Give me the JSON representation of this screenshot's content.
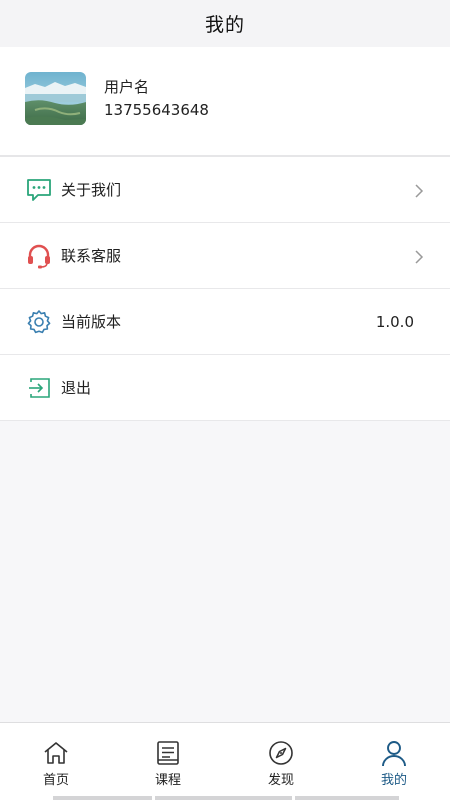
{
  "header": {
    "title": "我的"
  },
  "profile": {
    "avatar_icon": "landscape-avatar",
    "username": "用户名",
    "phone": "13755643648"
  },
  "menu": {
    "items": [
      {
        "label": "关于我们",
        "icon": "chat-bubble-icon",
        "has_chevron": true
      },
      {
        "label": "联系客服",
        "icon": "headset-icon",
        "has_chevron": true
      },
      {
        "label": "当前版本",
        "icon": "gear-icon",
        "value": "1.0.0"
      },
      {
        "label": "退出",
        "icon": "exit-icon"
      }
    ]
  },
  "tabbar": {
    "tabs": [
      {
        "label": "首页",
        "icon": "home-icon"
      },
      {
        "label": "课程",
        "icon": "book-icon"
      },
      {
        "label": "发现",
        "icon": "compass-icon"
      },
      {
        "label": "我的",
        "icon": "user-icon",
        "active": true
      }
    ]
  },
  "colors": {
    "accent_green": "#2aa57a",
    "accent_red": "#e05050",
    "accent_blue": "#3a7fb0",
    "active_tab": "#1d5a86"
  }
}
